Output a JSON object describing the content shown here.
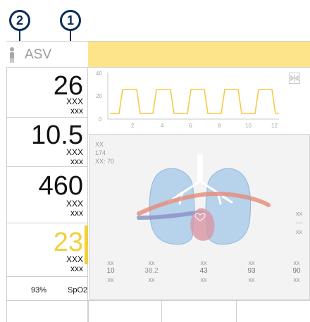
{
  "callouts": {
    "one": "1",
    "two": "2"
  },
  "mode": {
    "label": "ASV",
    "bar_color": "#fde489"
  },
  "params": [
    {
      "value": "26",
      "unit1": "XXX",
      "unit2": "xxx"
    },
    {
      "value": "10.5",
      "unit1": "XXX",
      "unit2": "xxx"
    },
    {
      "value": "460",
      "unit1": "XXX",
      "unit2": "xxx"
    },
    {
      "value": "23",
      "unit1": "XXX",
      "unit2": "xxx",
      "alarm_color": "#f3cf3b"
    }
  ],
  "spo2": {
    "value": "93%",
    "label": "SpO2"
  },
  "waveform": {
    "y_ticks": [
      "40",
      "20",
      "0"
    ],
    "x_ticks": [
      "2",
      "4",
      "6",
      "8",
      "10",
      "12"
    ],
    "line_color": "#f6c94a"
  },
  "lung_panel": {
    "info": [
      "XX",
      "174",
      "XX: 70"
    ],
    "side_values": [
      "xx",
      "---",
      "xx",
      "xx"
    ],
    "table": [
      {
        "head": "xx",
        "value": "10",
        "foot": "xx"
      },
      {
        "head": "xx",
        "value": "38.2",
        "foot": "xx"
      },
      {
        "head": "xx",
        "value": "43",
        "foot": "xx"
      },
      {
        "head": "xx",
        "value": "93",
        "foot": "xx"
      },
      {
        "head": "xx",
        "value": "90",
        "foot": "xx"
      }
    ]
  }
}
